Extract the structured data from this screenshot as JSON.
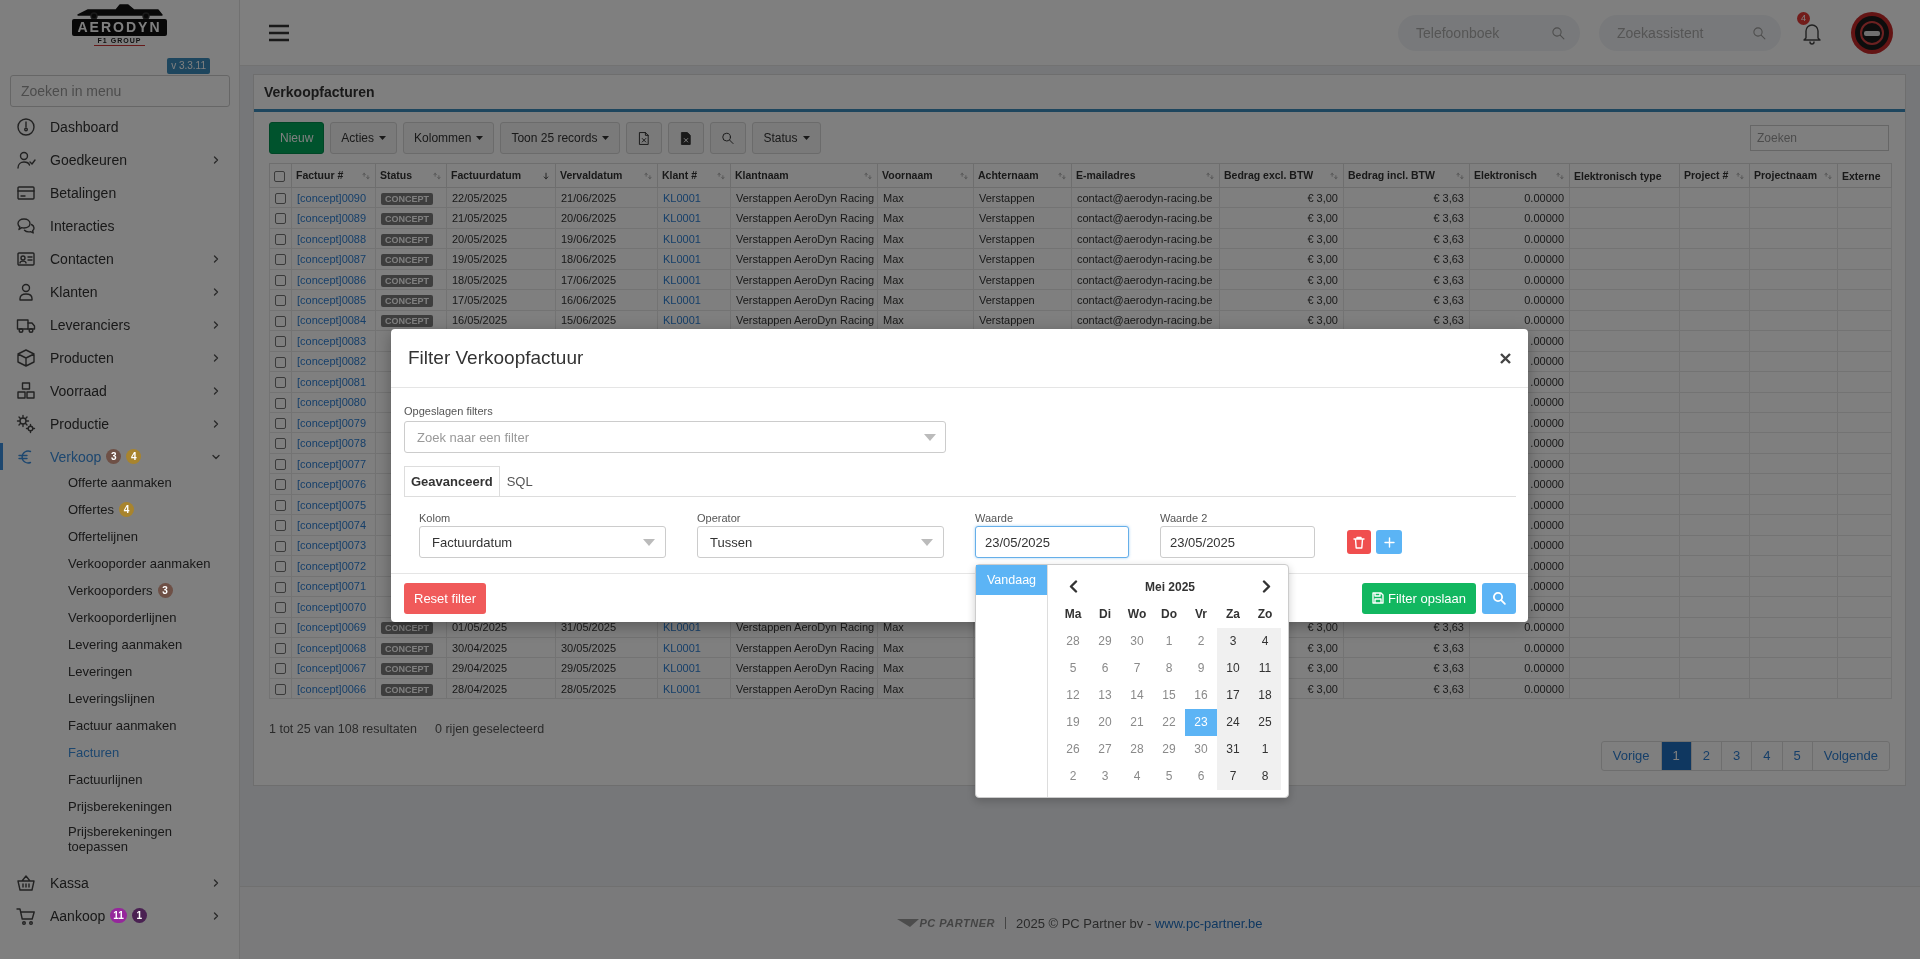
{
  "sidebar": {
    "logo": {
      "name": "AERODYN",
      "tagline": "F1 GROUP"
    },
    "version": "v 3.3.11",
    "search": {
      "placeholder": "Zoeken in menu"
    },
    "items": [
      {
        "label": "Dashboard",
        "submenu": false,
        "selected": false
      },
      {
        "label": "Goedkeuren",
        "submenu": true,
        "expanded": false,
        "selected": false
      },
      {
        "label": "Betalingen",
        "submenu": false,
        "selected": false
      },
      {
        "label": "Interacties",
        "submenu": false,
        "selected": false
      },
      {
        "label": "Contacten",
        "submenu": true,
        "expanded": false,
        "selected": false
      },
      {
        "label": "Klanten",
        "submenu": true,
        "expanded": false,
        "selected": false
      },
      {
        "label": "Leveranciers",
        "submenu": true,
        "expanded": false,
        "selected": false
      },
      {
        "label": "Producten",
        "submenu": true,
        "expanded": false,
        "selected": false
      },
      {
        "label": "Voorraad",
        "submenu": true,
        "expanded": false,
        "selected": false
      },
      {
        "label": "Productie",
        "submenu": true,
        "expanded": false,
        "selected": false
      },
      {
        "label": "Verkoop",
        "submenu": true,
        "expanded": true,
        "selected": true,
        "badges": [
          {
            "text": "3",
            "color": "#6e5046"
          },
          {
            "text": "4",
            "color": "#a8842e"
          }
        ],
        "children": [
          {
            "label": "Offerte aanmaken",
            "selected": false
          },
          {
            "label": "Offertes",
            "selected": false,
            "badges": [
              {
                "text": "4",
                "color": "#a8842e"
              }
            ]
          },
          {
            "label": "Offertelijnen",
            "selected": false
          },
          {
            "label": "Verkooporder aanmaken",
            "selected": false
          },
          {
            "label": "Verkooporders",
            "selected": false,
            "badges": [
              {
                "text": "3",
                "color": "#6e5046"
              }
            ]
          },
          {
            "label": "Verkooporderlijnen",
            "selected": false
          },
          {
            "label": "Levering aanmaken",
            "selected": false
          },
          {
            "label": "Leveringen",
            "selected": false
          },
          {
            "label": "Leveringslijnen",
            "selected": false
          },
          {
            "label": "Factuur aanmaken",
            "selected": false
          },
          {
            "label": "Facturen",
            "selected": true
          },
          {
            "label": "Factuurlijnen",
            "selected": false
          },
          {
            "label": "Prijsberekeningen",
            "selected": false
          },
          {
            "label": "Prijsberekeningen toepassen",
            "selected": false
          }
        ]
      },
      {
        "label": "Kassa",
        "submenu": true,
        "expanded": false,
        "selected": false
      },
      {
        "label": "Aankoop",
        "submenu": true,
        "expanded": false,
        "selected": false,
        "badges": [
          {
            "text": "11",
            "color": "#96279c"
          },
          {
            "text": "1",
            "color": "#4a2152"
          }
        ]
      }
    ]
  },
  "header": {
    "search_fields": [
      {
        "placeholder": "Telefoonboek"
      },
      {
        "placeholder": "Zoekassistent"
      }
    ],
    "notification_count": "4"
  },
  "page": {
    "title": "Verkoopfacturen",
    "toolbar": [
      {
        "kind": "primary",
        "label": "Nieuw"
      },
      {
        "kind": "dropdown",
        "label": "Acties"
      },
      {
        "kind": "dropdown",
        "label": "Kolommen"
      },
      {
        "kind": "dropdown",
        "label": "Toon 25 records"
      },
      {
        "kind": "icon"
      },
      {
        "kind": "icon"
      },
      {
        "kind": "icon"
      },
      {
        "kind": "dropdown",
        "label": "Status"
      }
    ],
    "search": {
      "placeholder": "Zoeken"
    },
    "table": {
      "select_all": {
        "checked": false
      },
      "columns": [
        {
          "label": "Factuur #",
          "sorted": false
        },
        {
          "label": "Status",
          "sorted": false
        },
        {
          "label": "Factuurdatum",
          "sorted": true
        },
        {
          "label": "Vervaldatum",
          "sorted": false
        },
        {
          "label": "Klant #",
          "sorted": false
        },
        {
          "label": "Klantnaam",
          "sorted": false
        },
        {
          "label": "Voornaam",
          "sorted": false
        },
        {
          "label": "Achternaam",
          "sorted": false
        },
        {
          "label": "E-mailadres",
          "sorted": false
        },
        {
          "label": "Bedrag excl. BTW",
          "sorted": false
        },
        {
          "label": "Bedrag incl. BTW",
          "sorted": false
        },
        {
          "label": "Elektronisch",
          "sorted": false
        },
        {
          "label": "Elektronisch type"
        },
        {
          "label": "Project #",
          "sorted": false
        },
        {
          "label": "Projectnaam",
          "sorted": false
        },
        {
          "label": "Externe"
        }
      ],
      "rows": [
        {
          "checked": false,
          "invoice": "[concept]0090",
          "status": "CONCEPT",
          "invoice_date": "22/05/2025",
          "due_date": "21/06/2025",
          "customer_no": "KL0001",
          "customer_name": "Verstappen AeroDyn Racing",
          "first_name": "Max",
          "last_name": "Verstappen",
          "email": "contact@aerodyn-racing.be",
          "amount_excl": "€ 3,00",
          "amount_incl": "€ 3,63",
          "electronic": "0.00000"
        },
        {
          "checked": false,
          "invoice": "[concept]0089",
          "status": "CONCEPT",
          "invoice_date": "21/05/2025",
          "due_date": "20/06/2025",
          "customer_no": "KL0001",
          "customer_name": "Verstappen AeroDyn Racing",
          "first_name": "Max",
          "last_name": "Verstappen",
          "email": "contact@aerodyn-racing.be",
          "amount_excl": "€ 3,00",
          "amount_incl": "€ 3,63",
          "electronic": "0.00000"
        },
        {
          "checked": false,
          "invoice": "[concept]0088",
          "status": "CONCEPT",
          "invoice_date": "20/05/2025",
          "due_date": "19/06/2025",
          "customer_no": "KL0001",
          "customer_name": "Verstappen AeroDyn Racing",
          "first_name": "Max",
          "last_name": "Verstappen",
          "email": "contact@aerodyn-racing.be",
          "amount_excl": "€ 3,00",
          "amount_incl": "€ 3,63",
          "electronic": "0.00000"
        },
        {
          "checked": false,
          "invoice": "[concept]0087",
          "status": "CONCEPT",
          "invoice_date": "19/05/2025",
          "due_date": "18/06/2025",
          "customer_no": "KL0001",
          "customer_name": "Verstappen AeroDyn Racing",
          "first_name": "Max",
          "last_name": "Verstappen",
          "email": "contact@aerodyn-racing.be",
          "amount_excl": "€ 3,00",
          "amount_incl": "€ 3,63",
          "electronic": "0.00000"
        },
        {
          "checked": false,
          "invoice": "[concept]0086",
          "status": "CONCEPT",
          "invoice_date": "18/05/2025",
          "due_date": "17/06/2025",
          "customer_no": "KL0001",
          "customer_name": "Verstappen AeroDyn Racing",
          "first_name": "Max",
          "last_name": "Verstappen",
          "email": "contact@aerodyn-racing.be",
          "amount_excl": "€ 3,00",
          "amount_incl": "€ 3,63",
          "electronic": "0.00000"
        },
        {
          "checked": false,
          "invoice": "[concept]0085",
          "status": "CONCEPT",
          "invoice_date": "17/05/2025",
          "due_date": "16/06/2025",
          "customer_no": "KL0001",
          "customer_name": "Verstappen AeroDyn Racing",
          "first_name": "Max",
          "last_name": "Verstappen",
          "email": "contact@aerodyn-racing.be",
          "amount_excl": "€ 3,00",
          "amount_incl": "€ 3,63",
          "electronic": "0.00000"
        },
        {
          "checked": false,
          "invoice": "[concept]0084",
          "status": "CONCEPT",
          "invoice_date": "16/05/2025",
          "due_date": "15/06/2025",
          "customer_no": "KL0001",
          "customer_name": "Verstappen AeroDyn Racing",
          "first_name": "Max",
          "last_name": "Verstappen",
          "email": "contact@aerodyn-racing.be",
          "amount_excl": "€ 3,00",
          "amount_incl": "€ 3,63",
          "electronic": "0.00000"
        },
        {
          "checked": false,
          "invoice": "[concept]0083",
          "electronic": ".00000"
        },
        {
          "checked": false,
          "invoice": "[concept]0082",
          "electronic": ".00000"
        },
        {
          "checked": false,
          "invoice": "[concept]0081",
          "electronic": ".00000"
        },
        {
          "checked": false,
          "invoice": "[concept]0080",
          "electronic": ".00000"
        },
        {
          "checked": false,
          "invoice": "[concept]0079",
          "electronic": ".00000"
        },
        {
          "checked": false,
          "invoice": "[concept]0078",
          "electronic": ".00000"
        },
        {
          "checked": false,
          "invoice": "[concept]0077",
          "electronic": ".00000"
        },
        {
          "checked": false,
          "invoice": "[concept]0076",
          "electronic": ".00000"
        },
        {
          "checked": false,
          "invoice": "[concept]0075",
          "electronic": ".00000"
        },
        {
          "checked": false,
          "invoice": "[concept]0074",
          "electronic": ".00000"
        },
        {
          "checked": false,
          "invoice": "[concept]0073",
          "electronic": ".00000"
        },
        {
          "checked": false,
          "invoice": "[concept]0072",
          "electronic": ".00000"
        },
        {
          "checked": false,
          "invoice": "[concept]0071",
          "electronic": ".00000"
        },
        {
          "checked": false,
          "invoice": "[concept]0070",
          "electronic": ".00000"
        },
        {
          "checked": false,
          "invoice": "[concept]0069",
          "status": "CONCEPT",
          "invoice_date": "01/05/2025",
          "due_date": "31/05/2025",
          "customer_no": "KL0001",
          "customer_name": "Verstappen AeroDyn Racing",
          "first_name": "Max",
          "amount_excl": "€ 3,00",
          "amount_incl": "€ 3,63",
          "electronic": "0.00000"
        },
        {
          "checked": false,
          "invoice": "[concept]0068",
          "status": "CONCEPT",
          "invoice_date": "30/04/2025",
          "due_date": "30/05/2025",
          "customer_no": "KL0001",
          "customer_name": "Verstappen AeroDyn Racing",
          "first_name": "Max",
          "amount_excl": "€ 3,00",
          "amount_incl": "€ 3,63",
          "electronic": "0.00000"
        },
        {
          "checked": false,
          "invoice": "[concept]0067",
          "status": "CONCEPT",
          "invoice_date": "29/04/2025",
          "due_date": "29/05/2025",
          "customer_no": "KL0001",
          "customer_name": "Verstappen AeroDyn Racing",
          "first_name": "Max",
          "amount_excl": "€ 3,00",
          "amount_incl": "€ 3,63",
          "electronic": "0.00000"
        },
        {
          "checked": false,
          "invoice": "[concept]0066",
          "status": "CONCEPT",
          "invoice_date": "28/04/2025",
          "due_date": "28/05/2025",
          "customer_no": "KL0001",
          "customer_name": "Verstappen AeroDyn Racing",
          "first_name": "Max",
          "amount_excl": "€ 3,00",
          "amount_incl": "€ 3,63",
          "electronic": "0.00000"
        }
      ]
    },
    "summary": "1 tot 25 van 108 resultaten",
    "selection": "0 rijen geselecteerd",
    "pagination": [
      {
        "label": "Vorige",
        "selected": false
      },
      {
        "label": "1",
        "selected": true
      },
      {
        "label": "2",
        "selected": false
      },
      {
        "label": "3",
        "selected": false
      },
      {
        "label": "4",
        "selected": false
      },
      {
        "label": "5",
        "selected": false
      },
      {
        "label": "Volgende",
        "selected": false
      }
    ]
  },
  "footer": {
    "brand": "PC PARTNER",
    "copyright": "2025 © PC Partner bv -",
    "link": "www.pc-partner.be"
  },
  "modal": {
    "title": "Filter Verkoopfactuur",
    "saved_filters": {
      "label": "Opgeslagen filters",
      "placeholder": "Zoek naar een filter"
    },
    "tabs": [
      {
        "label": "Geavanceerd",
        "selected": true
      },
      {
        "label": "SQL",
        "selected": false
      }
    ],
    "conditions": [
      {
        "label": "Kolom",
        "kind": "select",
        "value": "Factuurdatum",
        "focused": false
      },
      {
        "label": "Operator",
        "kind": "select",
        "value": "Tussen",
        "focused": false
      },
      {
        "label": "Waarde",
        "kind": "text",
        "value": "23/05/2025",
        "focused": true
      },
      {
        "label": "Waarde 2",
        "kind": "text",
        "value": "23/05/2025",
        "focused": false
      }
    ],
    "reset": "Reset filter",
    "save": "Filter opslaan"
  },
  "date_picker": {
    "today": "Vandaag",
    "month": "Mei 2025",
    "weekdays": [
      "Ma",
      "Di",
      "Wo",
      "Do",
      "Vr",
      "Za",
      "Zo"
    ],
    "weeks": [
      [
        {
          "day": "28",
          "weekend": false,
          "selected": false
        },
        {
          "day": "29",
          "weekend": false,
          "selected": false
        },
        {
          "day": "30",
          "weekend": false,
          "selected": false
        },
        {
          "day": "1",
          "weekend": false,
          "selected": false
        },
        {
          "day": "2",
          "weekend": false,
          "selected": false
        },
        {
          "day": "3",
          "weekend": true,
          "selected": false
        },
        {
          "day": "4",
          "weekend": true,
          "selected": false
        }
      ],
      [
        {
          "day": "5",
          "weekend": false,
          "selected": false
        },
        {
          "day": "6",
          "weekend": false,
          "selected": false
        },
        {
          "day": "7",
          "weekend": false,
          "selected": false
        },
        {
          "day": "8",
          "weekend": false,
          "selected": false
        },
        {
          "day": "9",
          "weekend": false,
          "selected": false
        },
        {
          "day": "10",
          "weekend": true,
          "selected": false
        },
        {
          "day": "11",
          "weekend": true,
          "selected": false
        }
      ],
      [
        {
          "day": "12",
          "weekend": false,
          "selected": false
        },
        {
          "day": "13",
          "weekend": false,
          "selected": false
        },
        {
          "day": "14",
          "weekend": false,
          "selected": false
        },
        {
          "day": "15",
          "weekend": false,
          "selected": false
        },
        {
          "day": "16",
          "weekend": false,
          "selected": false
        },
        {
          "day": "17",
          "weekend": true,
          "selected": false
        },
        {
          "day": "18",
          "weekend": true,
          "selected": false
        }
      ],
      [
        {
          "day": "19",
          "weekend": false,
          "selected": false
        },
        {
          "day": "20",
          "weekend": false,
          "selected": false
        },
        {
          "day": "21",
          "weekend": false,
          "selected": false
        },
        {
          "day": "22",
          "weekend": false,
          "selected": false
        },
        {
          "day": "23",
          "weekend": false,
          "selected": true
        },
        {
          "day": "24",
          "weekend": true,
          "selected": false
        },
        {
          "day": "25",
          "weekend": true,
          "selected": false
        }
      ],
      [
        {
          "day": "26",
          "weekend": false,
          "selected": false
        },
        {
          "day": "27",
          "weekend": false,
          "selected": false
        },
        {
          "day": "28",
          "weekend": false,
          "selected": false
        },
        {
          "day": "29",
          "weekend": false,
          "selected": false
        },
        {
          "day": "30",
          "weekend": false,
          "selected": false
        },
        {
          "day": "31",
          "weekend": true,
          "selected": false
        },
        {
          "day": "1",
          "weekend": true,
          "selected": false
        }
      ],
      [
        {
          "day": "2",
          "weekend": false,
          "selected": false
        },
        {
          "day": "3",
          "weekend": false,
          "selected": false
        },
        {
          "day": "4",
          "weekend": false,
          "selected": false
        },
        {
          "day": "5",
          "weekend": false,
          "selected": false
        },
        {
          "day": "6",
          "weekend": false,
          "selected": false
        },
        {
          "day": "7",
          "weekend": true,
          "selected": false
        },
        {
          "day": "8",
          "weekend": true,
          "selected": false
        }
      ]
    ]
  }
}
